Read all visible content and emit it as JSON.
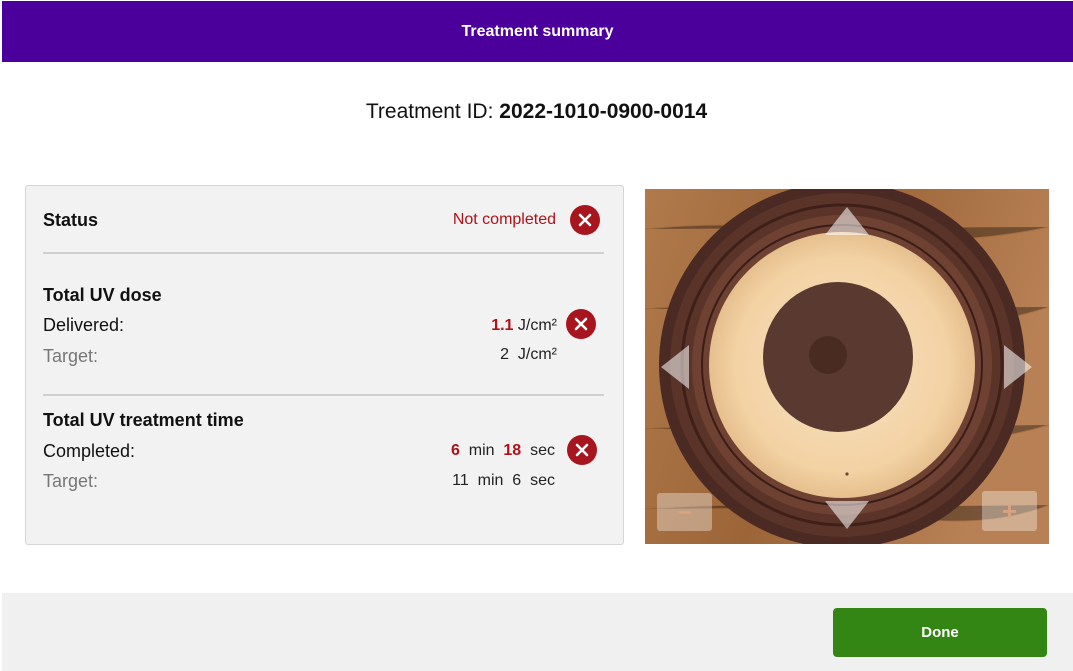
{
  "header": {
    "title": "Treatment summary"
  },
  "treatment": {
    "id_label": "Treatment ID:",
    "id_value": "2022-1010-0900-0014"
  },
  "status": {
    "label": "Status",
    "value": "Not completed"
  },
  "uv_dose": {
    "title": "Total UV dose",
    "delivered_label": "Delivered:",
    "delivered_value": "1.1",
    "delivered_unit": "J/cm²",
    "target_label": "Target:",
    "target_value": "2",
    "target_unit": "J/cm²"
  },
  "treatment_time": {
    "title": "Total UV treatment time",
    "completed_label": "Completed:",
    "completed_min": "6",
    "completed_sec": "18",
    "target_label": "Target:",
    "target_min": "11",
    "target_sec": "6",
    "min_unit": "min",
    "sec_unit": "sec"
  },
  "image_controls": {
    "zoom_out": "−",
    "zoom_in": "+"
  },
  "footer": {
    "done_label": "Done"
  },
  "colors": {
    "header": "#4b009c",
    "error": "#a8151f",
    "done": "#338514"
  }
}
